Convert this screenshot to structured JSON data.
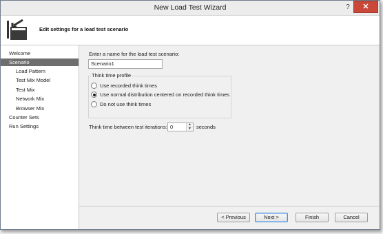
{
  "window": {
    "title": "New Load Test Wizard",
    "help_label": "?",
    "close_label": "✕"
  },
  "header": {
    "text": "Edit settings for a load test scenario",
    "icon": "wizard-scenario-icon"
  },
  "nav": {
    "items": [
      {
        "label": "Welcome",
        "level": 0,
        "selected": false
      },
      {
        "label": "Scenario",
        "level": 0,
        "selected": true
      },
      {
        "label": "Load Pattern",
        "level": 1,
        "selected": false
      },
      {
        "label": "Test Mix Model",
        "level": 1,
        "selected": false
      },
      {
        "label": "Test Mix",
        "level": 1,
        "selected": false
      },
      {
        "label": "Network Mix",
        "level": 1,
        "selected": false
      },
      {
        "label": "Browser Mix",
        "level": 1,
        "selected": false
      },
      {
        "label": "Counter Sets",
        "level": 0,
        "selected": false
      },
      {
        "label": "Run Settings",
        "level": 0,
        "selected": false
      }
    ]
  },
  "scenario": {
    "name_label": "Enter a name for the load test scenario:",
    "name_value": "Scenario1",
    "think_profile_title": "Think time profile",
    "options": [
      {
        "label": "Use recorded think times",
        "selected": false
      },
      {
        "label": "Use normal distribution centered on recorded think times",
        "selected": true
      },
      {
        "label": "Do not use think times",
        "selected": false
      }
    ],
    "iteration_label": "Think time between test iterations:",
    "iteration_value": "0",
    "iteration_unit": "seconds"
  },
  "buttons": {
    "previous": "< Previous",
    "next": "Next >",
    "finish": "Finish",
    "cancel": "Cancel"
  }
}
